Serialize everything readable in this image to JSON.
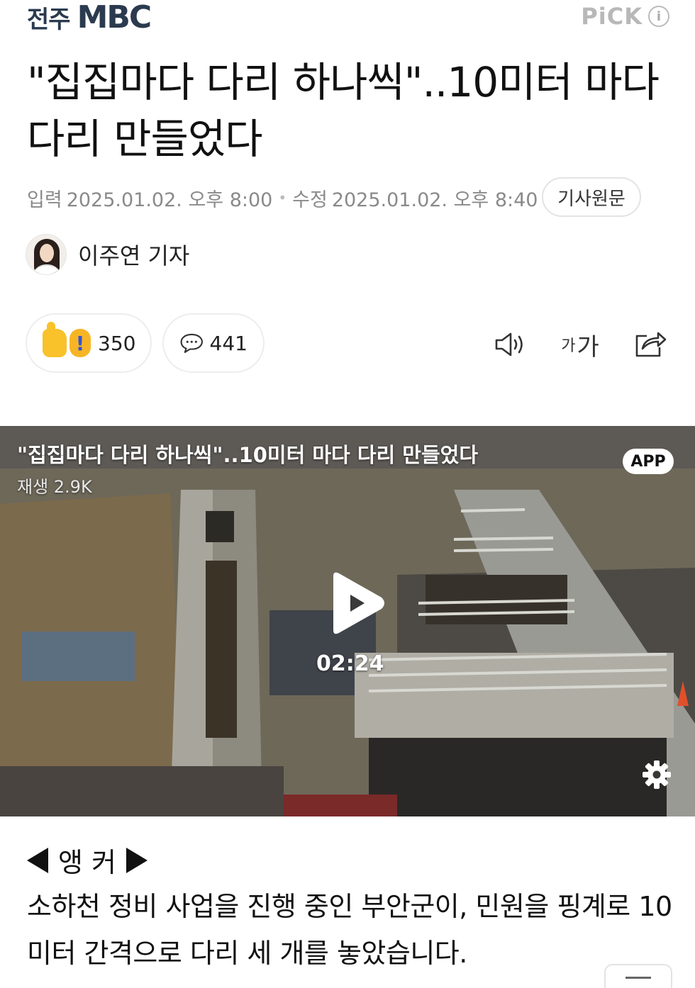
{
  "header": {
    "press_region": "전주",
    "press_brand": "MBC",
    "pick_label": "PiCK",
    "info_glyph": "i"
  },
  "article": {
    "title": "\"집집마다 다리 하나씩\"..10미터 마다 다리 만들었다",
    "published_label": "입력",
    "published": "2025.01.02. 오후 8:00",
    "modified_label": "수정",
    "modified": "2025.01.02. 오후 8:40",
    "original_button": "기사원문",
    "reporter": "이주연 기자"
  },
  "reactions": {
    "like_count": "350",
    "comment_count": "441"
  },
  "tools": {
    "audio_icon": "speaker-icon",
    "font_small": "가",
    "font_large": "가",
    "share_icon": "share-icon"
  },
  "video": {
    "title": "\"집집마다 다리 하나씩\"..10미터 마다 다리 만들었다",
    "views": "재생 2.9K",
    "app_badge": "APP",
    "duration": "02:24"
  },
  "body": {
    "anchor_label": "앵 커",
    "paragraph": "소하천 정비 사업을 진행 중인 부안군이, 민원을 핑계로 10미터 간격으로 다리 세 개를 놓았습니다."
  },
  "colors": {
    "brand": "#2b3a4e",
    "meta_gray": "#8a8a8a",
    "pill_border": "#ededed"
  }
}
